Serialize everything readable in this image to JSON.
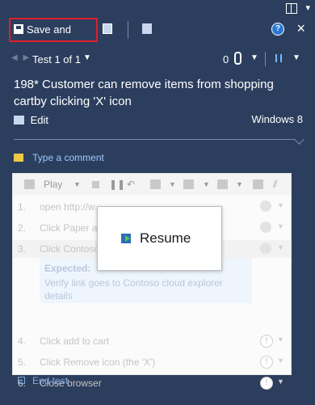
{
  "toolbar": {
    "save_close_label": "Save and Close"
  },
  "navbar": {
    "test_position": "Test 1 of 1",
    "attachment_count": "0"
  },
  "test": {
    "title": "198* Customer can remove items from shopping cartby clicking 'X' icon",
    "edit_label": "Edit",
    "platform": "Windows 8"
  },
  "comment": {
    "placeholder": "Type a comment"
  },
  "runner": {
    "play_label": "Play"
  },
  "steps": [
    {
      "num": "1.",
      "text": "open http://w..."
    },
    {
      "num": "2.",
      "text": "Click Paper an..."
    },
    {
      "num": "3.",
      "text": "Click Contoso..."
    },
    {
      "num": "4.",
      "text": "Click add to cart"
    },
    {
      "num": "5.",
      "text": "Click Remove icon (the 'X')"
    },
    {
      "num": "6.",
      "text": "Close browser"
    }
  ],
  "expected": {
    "heading": "Expected:",
    "body": "Verify link goes to Contoso cloud explorer details"
  },
  "end_test_label": "End test",
  "modal": {
    "label": "Resume"
  },
  "colors": {
    "window_bg": "#2c3e5e",
    "highlight_border": "#e01d2c",
    "link_blue": "#9cc8ff"
  }
}
